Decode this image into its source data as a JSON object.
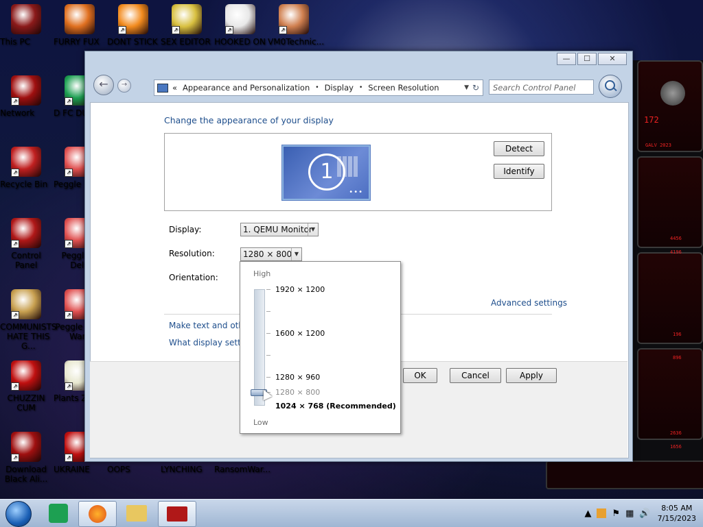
{
  "desktop_icons": [
    {
      "label": "This PC",
      "color": "#8b1a1a"
    },
    {
      "label": "FURRY FUX",
      "color": "#e07020"
    },
    {
      "label": "DONT STICK",
      "color": "#f28b1e"
    },
    {
      "label": "SEX EDITOR",
      "color": "#d8c040"
    },
    {
      "label": "HOOKED ON",
      "color": "#e8e8e8"
    },
    {
      "label": "VM0Technic...",
      "color": "#d08050"
    },
    {
      "label": "Network",
      "color": "#a01010"
    },
    {
      "label": "D FC DUMB",
      "color": "#1da052"
    },
    {
      "label": "Recycle Bin",
      "color": "#c02020"
    },
    {
      "label": "Peggle D",
      "color": "#e05050"
    },
    {
      "label": "Control Panel",
      "color": "#b01818"
    },
    {
      "label": "Peggle N Delu",
      "color": "#e05050"
    },
    {
      "label": "COMMUNISTS HATE THIS G...",
      "color": "#c8a050"
    },
    {
      "label": "Peggle W of Warc",
      "color": "#e05050"
    },
    {
      "label": "CHUZZIN CUM",
      "color": "#c01010"
    },
    {
      "label": "Plants Zomb",
      "color": "#e8e8d0"
    },
    {
      "label": "Download Black Ali...",
      "color": "#a01010"
    },
    {
      "label": "UKRAINE",
      "color": "#c01010"
    },
    {
      "label": "OOPS",
      "color": "#8b1a1a"
    },
    {
      "label": "LYNCHING",
      "color": "#8b1a1a"
    },
    {
      "label": "RansomWar...",
      "color": "#8b1a1a"
    }
  ],
  "window": {
    "caption": {
      "minimize": "—",
      "maximize": "☐",
      "close": "✕"
    },
    "address": {
      "chevrons": "«",
      "crumbs": [
        "Appearance and Personalization",
        "Display",
        "Screen Resolution"
      ],
      "sep": "•"
    },
    "search_placeholder": "Search Control Panel",
    "heading": "Change the appearance of your display",
    "monitor_number": "1",
    "detect_label": "Detect",
    "identify_label": "Identify",
    "display_label": "Display:",
    "display_value": "1. QEMU Monitor",
    "resolution_label": "Resolution:",
    "resolution_value": "1280 × 800",
    "orientation_label": "Orientation:",
    "advanced_link": "Advanced settings",
    "make_text_link": "Make text and other",
    "what_display_link": "What display setting",
    "ok_label": "OK",
    "cancel_label": "Cancel",
    "apply_label": "Apply"
  },
  "resolution_dropdown": {
    "high_label": "High",
    "low_label": "Low",
    "options": [
      {
        "label": "1920 × 1200",
        "style": "normal"
      },
      {
        "label": "1600 × 1200",
        "style": "normal"
      },
      {
        "label": "1280 × 960",
        "style": "normal"
      },
      {
        "label": "1280 × 800",
        "style": "dim"
      },
      {
        "label": "1024 × 768 (Recommended)",
        "style": "bold"
      }
    ]
  },
  "taskbar": {
    "time": "8:05 AM",
    "date": "7/15/2023"
  },
  "skin": {
    "readouts": [
      "172",
      "GALV 2023",
      "4456",
      "4196",
      "196",
      "896",
      "2636",
      "1656"
    ]
  }
}
